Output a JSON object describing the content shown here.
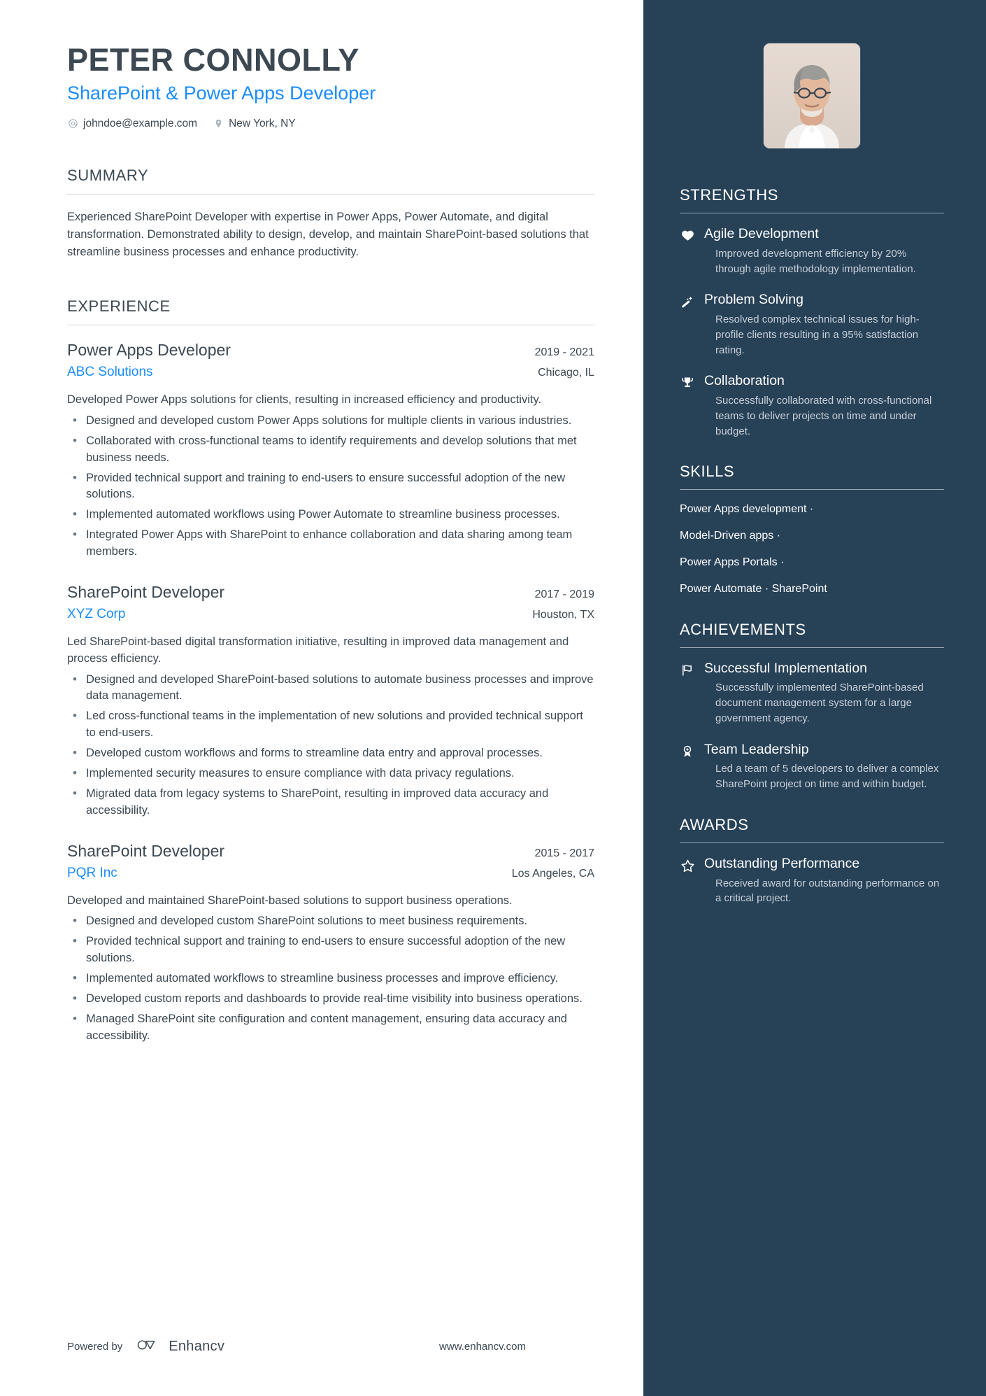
{
  "header": {
    "name": "PETER CONNOLLY",
    "headline": "SharePoint & Power Apps Developer",
    "email": "johndoe@example.com",
    "location": "New York, NY",
    "email_icon": "at-sign-icon",
    "location_icon": "map-pin-icon",
    "photo_alt": "profile-photo"
  },
  "accent_color": "#1a8cff",
  "sidebar_color": "#274157",
  "text_color": "#3c4852",
  "summary": {
    "title": "SUMMARY",
    "text": "Experienced SharePoint Developer with expertise in Power Apps, Power Automate, and digital transformation. Demonstrated ability to design, develop, and maintain SharePoint-based solutions that streamline business processes and enhance productivity."
  },
  "experience": {
    "title": "EXPERIENCE",
    "jobs": [
      {
        "title": "Power Apps Developer",
        "company": "ABC Solutions",
        "dates": "2019 - 2021",
        "location": "Chicago, IL",
        "description": "Developed Power Apps solutions for clients, resulting in increased efficiency and productivity.",
        "bullets": [
          "Designed and developed custom Power Apps solutions for multiple clients in various industries.",
          "Collaborated with cross-functional teams to identify requirements and develop solutions that met business needs.",
          "Provided technical support and training to end-users to ensure successful adoption of the new solutions.",
          "Implemented automated workflows using Power Automate to streamline business processes.",
          "Integrated Power Apps with SharePoint to enhance collaboration and data sharing among team members."
        ]
      },
      {
        "title": "SharePoint Developer",
        "company": "XYZ Corp",
        "dates": "2017 - 2019",
        "location": "Houston, TX",
        "description": "Led SharePoint-based digital transformation initiative, resulting in improved data management and process efficiency.",
        "bullets": [
          "Designed and developed SharePoint-based solutions to automate business processes and improve data management.",
          "Led cross-functional teams in the implementation of new solutions and provided technical support to end-users.",
          "Developed custom workflows and forms to streamline data entry and approval processes.",
          "Implemented security measures to ensure compliance with data privacy regulations.",
          "Migrated data from legacy systems to SharePoint, resulting in improved data accuracy and accessibility."
        ]
      },
      {
        "title": "SharePoint Developer",
        "company": "PQR Inc",
        "dates": "2015 - 2017",
        "location": "Los Angeles, CA",
        "description": "Developed and maintained SharePoint-based solutions to support business operations.",
        "bullets": [
          "Designed and developed custom SharePoint solutions to meet business requirements.",
          "Provided technical support and training to end-users to ensure successful adoption of the new solutions.",
          "Implemented automated workflows to streamline business processes and improve efficiency.",
          "Developed custom reports and dashboards to provide real-time visibility into business operations.",
          "Managed SharePoint site configuration and content management, ensuring data accuracy and accessibility."
        ]
      }
    ]
  },
  "strengths": {
    "title": "STRENGTHS",
    "items": [
      {
        "icon": "heart-icon",
        "title": "Agile Development",
        "desc": "Improved development efficiency by 20% through agile methodology implementation."
      },
      {
        "icon": "magic-wand-icon",
        "title": "Problem Solving",
        "desc": "Resolved complex technical issues for high-profile clients resulting in a 95% satisfaction rating."
      },
      {
        "icon": "trophy-icon",
        "title": "Collaboration",
        "desc": "Successfully collaborated with cross-functional teams to deliver projects on time and under budget."
      }
    ]
  },
  "skills": {
    "title": "SKILLS",
    "lines": [
      "Power Apps development ·",
      "Model-Driven apps ·",
      "Power Apps Portals ·",
      "Power Automate · SharePoint"
    ]
  },
  "achievements": {
    "title": "ACHIEVEMENTS",
    "items": [
      {
        "icon": "flag-icon",
        "title": "Successful Implementation",
        "desc": "Successfully implemented SharePoint-based document management system for a large government agency."
      },
      {
        "icon": "award-medal-icon",
        "title": "Team Leadership",
        "desc": "Led a team of 5 developers to deliver a complex SharePoint project on time and within budget."
      }
    ]
  },
  "awards": {
    "title": "AWARDS",
    "items": [
      {
        "icon": "star-icon",
        "title": "Outstanding Performance",
        "desc": "Received award for outstanding performance on a critical project."
      }
    ]
  },
  "footer": {
    "powered_by": "Powered by",
    "brand": "Enhancv",
    "url": "www.enhancv.com",
    "logo_icon": "enhancv-logo-icon"
  }
}
